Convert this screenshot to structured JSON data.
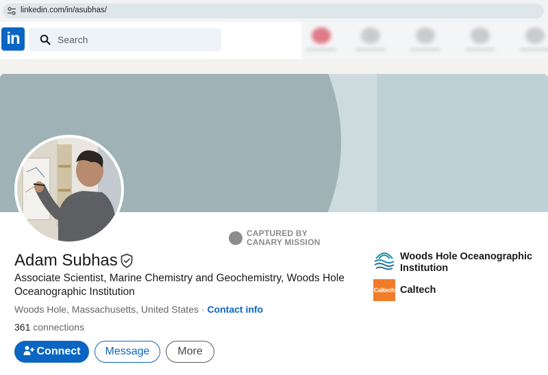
{
  "browser": {
    "url": "linkedin.com/in/asubhas/"
  },
  "nav": {
    "logo_text": "in",
    "search_placeholder": "Search"
  },
  "watermark": {
    "line1": "CAPTURED BY",
    "line2": "CANARY MISSION"
  },
  "profile": {
    "name": "Adam Subhas",
    "headline": "Associate Scientist, Marine Chemistry and Geochemistry, Woods Hole Oceanographic Institution",
    "location": "Woods Hole, Massachusetts, United States",
    "separator": " · ",
    "contact_info": "Contact info",
    "connections_count": "361",
    "connections_label": " connections"
  },
  "actions": {
    "connect": "Connect",
    "message": "Message",
    "more": "More"
  },
  "organizations": [
    {
      "name": "Woods Hole Oceanographic Institution",
      "icon": "whoi-logo-icon"
    },
    {
      "name": "Caltech",
      "logo_text": "Caltech",
      "icon": "caltech-logo-icon"
    }
  ],
  "colors": {
    "linkedin_blue": "#0a66c2",
    "caltech_orange": "#f07c2a",
    "whoi_teal": "#1a8ea8"
  }
}
